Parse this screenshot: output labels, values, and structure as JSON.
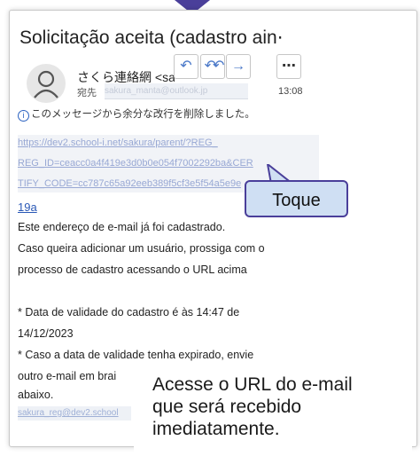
{
  "email": {
    "subject": "Solicitação aceita (cadastro ain⋯",
    "sender": "さくら連絡網 <saku",
    "to_label": "宛先",
    "to_address": "sakura_manta@outlook.jp",
    "time": "13:08",
    "actions": [
      {
        "name": "reply",
        "glyph": "↶"
      },
      {
        "name": "reply-all",
        "glyph": "↶↶"
      },
      {
        "name": "forward",
        "glyph": "→"
      },
      {
        "name": "more",
        "glyph": "⋯"
      }
    ],
    "notice": "このメッセージから余分な改行を削除しました。",
    "notice_icon": "i",
    "url_lines": [
      "https://dev2.school-i.net/sakura/parent/?REG_",
      "REG_ID=ceacc0a4f419e3d0b0e054f7002292ba&CER",
      "TIFY_CODE=cc787c65a92eeb389f5cf3e5f54a5e9e"
    ],
    "url_end": "19a",
    "body_lines": [
      "Este endereço de e-mail já foi cadastrado.",
      "Caso queira adicionar um usuário, prossiga com o",
      "processo de cadastro acessando o URL acima",
      "",
      "* Data de validade do cadastro é às 14:47 de",
      "14/12/2023",
      "* Caso a data de validade tenha expirado, envie",
      "outro e-mail em brai",
      "abaixo."
    ],
    "reply_address": "sakura_reg@dev2.school"
  },
  "callout": {
    "tap": "Toque"
  },
  "overlay": {
    "text": "Acesse o URL do e-mail\nque será recebido\nimediatamente."
  },
  "colors": {
    "accent": "#4a3f9a",
    "callout_bg": "#cfdff3",
    "link": "#2a58b6"
  }
}
